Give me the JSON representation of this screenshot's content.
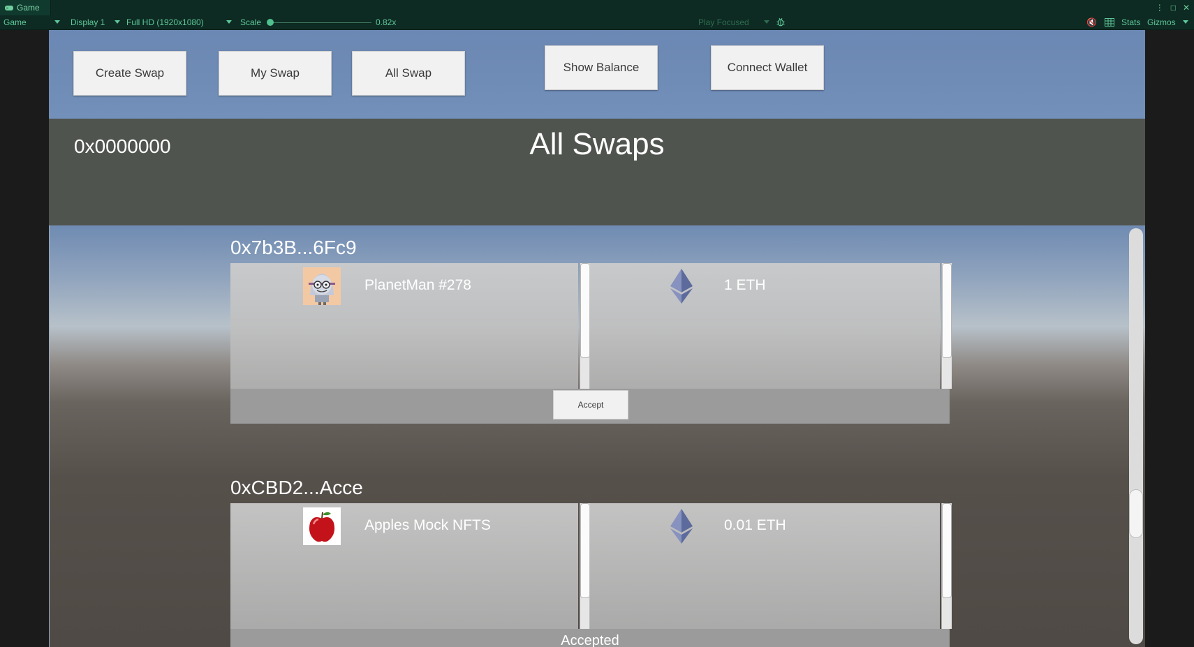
{
  "editor": {
    "tab_label": "Game",
    "toolbar": {
      "view_label": "Game",
      "display": "Display 1",
      "resolution": "Full HD (1920x1080)",
      "scale_label": "Scale",
      "scale_value": "0.82x",
      "play_mode": "Play Focused",
      "stats": "Stats",
      "gizmos": "Gizmos"
    }
  },
  "nav": {
    "create_swap": "Create Swap",
    "my_swap": "My Swap",
    "all_swap": "All Swap",
    "show_balance": "Show Balance",
    "connect_wallet": "Connect Wallet"
  },
  "header": {
    "wallet_address": "0x0000000",
    "title": "All Swaps"
  },
  "swaps": [
    {
      "address": "0x7b3B...6Fc9",
      "item_name": "PlanetMan #278",
      "item_icon": "planetman-nft-thumbnail",
      "amount": "1 ETH",
      "currency_icon": "ethereum-icon",
      "action": "Accept"
    },
    {
      "address": "0xCBD2...Acce",
      "item_name": "Apples Mock NFTS",
      "item_icon": "red-apple-thumbnail",
      "amount": "0.01 ETH",
      "currency_icon": "ethereum-icon",
      "status": "Accepted"
    }
  ],
  "colors": {
    "top_bar": "#7290b9",
    "header_bg": "#50544e",
    "button_bg": "#f1f1f1",
    "editor_accent": "#5ec79b"
  }
}
